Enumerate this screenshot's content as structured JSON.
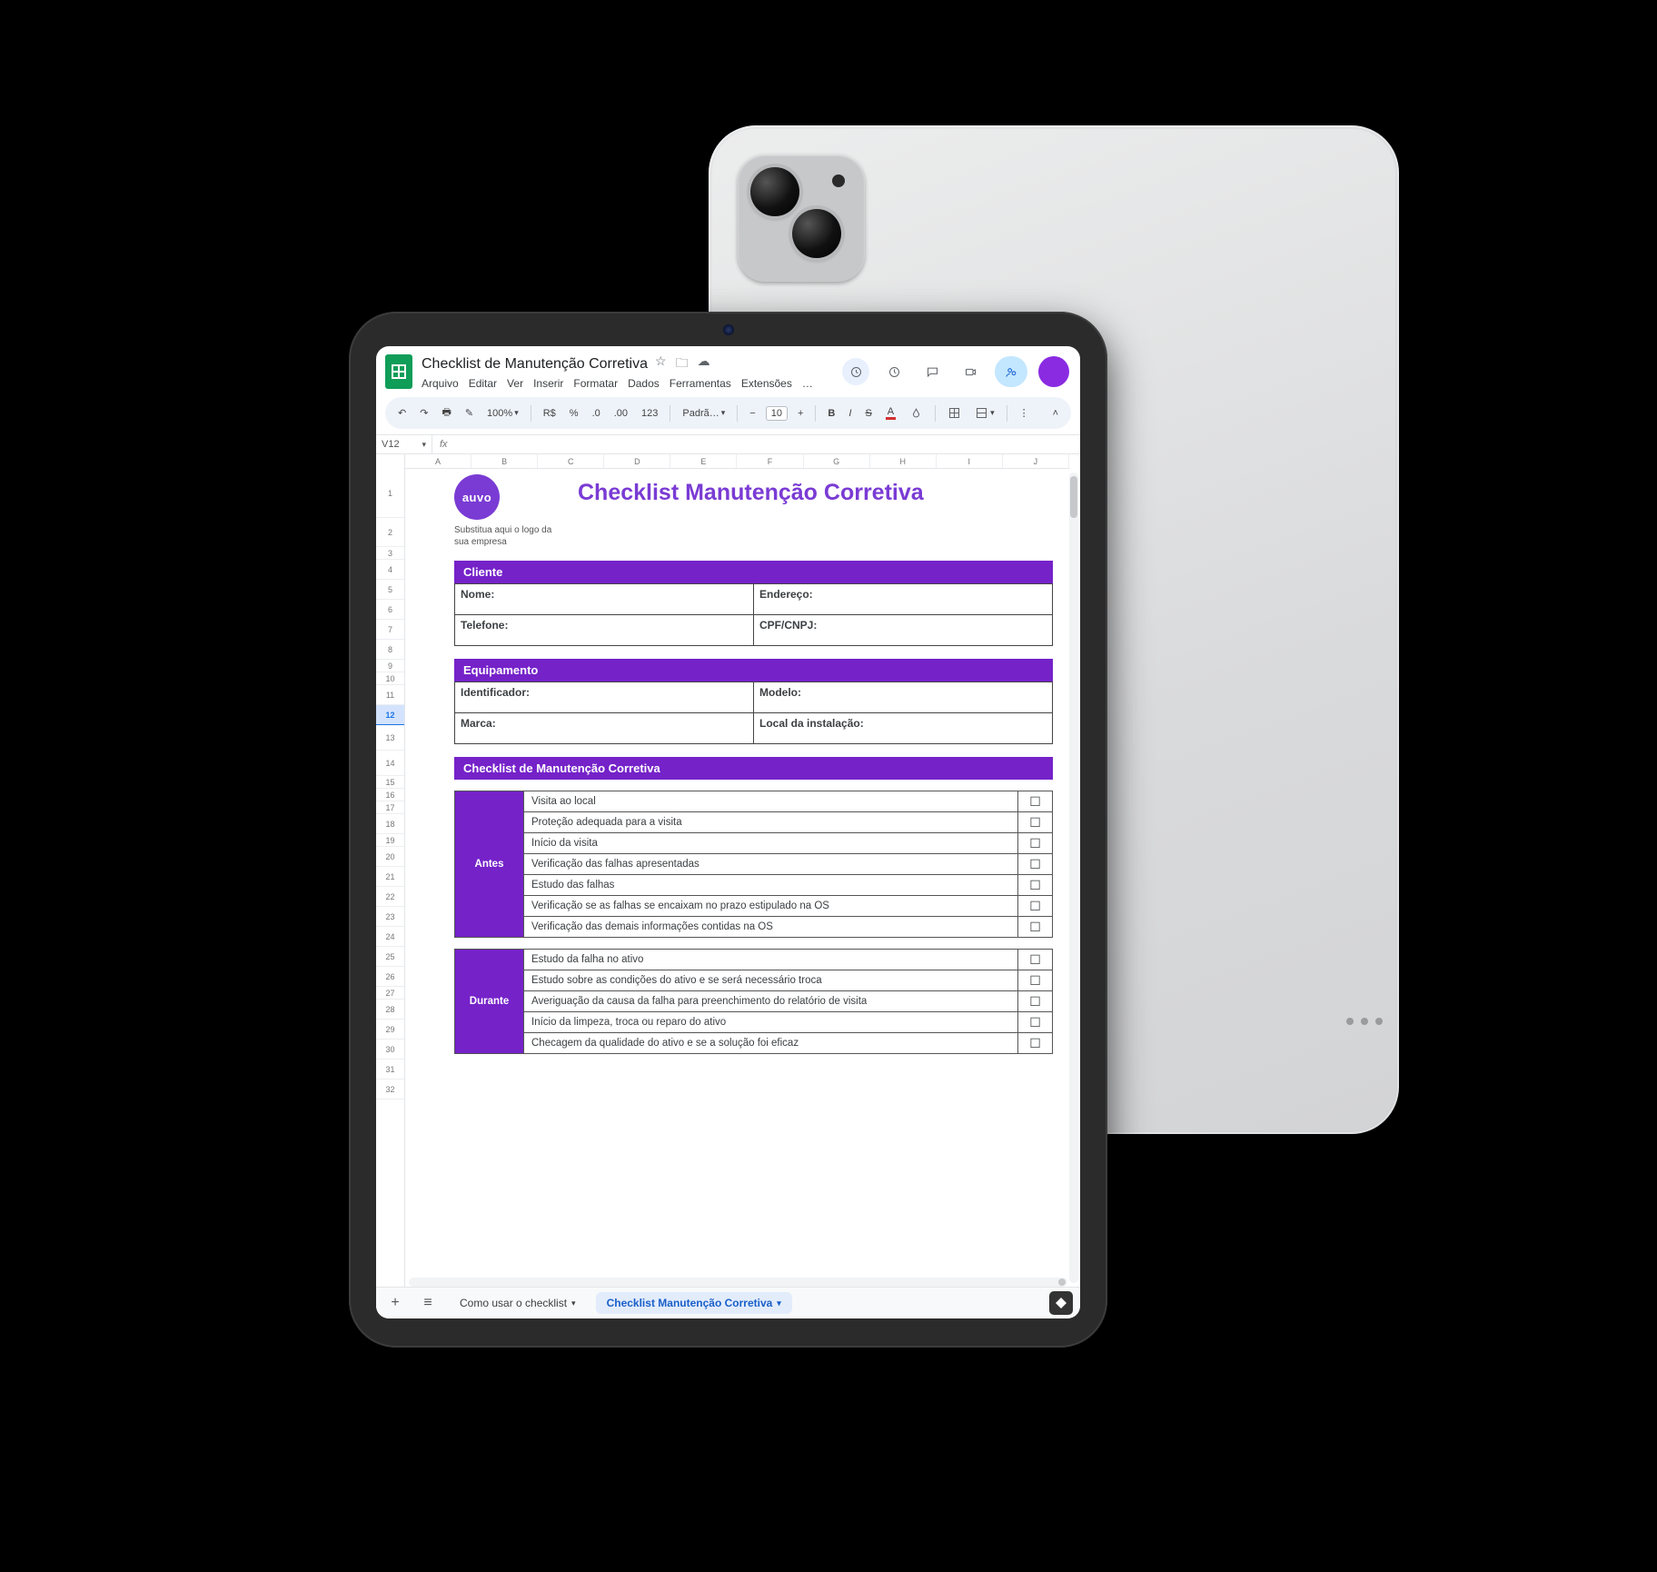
{
  "doc": {
    "title": "Checklist de Manutenção Corretiva",
    "menus": [
      "Arquivo",
      "Editar",
      "Ver",
      "Inserir",
      "Formatar",
      "Dados",
      "Ferramentas",
      "Extensões",
      "…"
    ]
  },
  "toolbar": {
    "zoom": "100%",
    "currency": "R$",
    "percent": "%",
    "dec_dec": ".0",
    "dec_inc": ".00",
    "num123": "123",
    "font": "Padrã…",
    "font_size": "10"
  },
  "fx": {
    "cell": "V12"
  },
  "columns": [
    "A",
    "B",
    "C",
    "D",
    "E",
    "F",
    "G",
    "H",
    "I",
    "J"
  ],
  "row_heights": [
    {
      "n": "1",
      "cls": "rh-tall"
    },
    {
      "n": "2",
      "cls": "rh-medhi"
    },
    {
      "n": "3",
      "cls": "rh-short"
    },
    {
      "n": "4",
      "cls": "rh-norm"
    },
    {
      "n": "5",
      "cls": "rh-norm"
    },
    {
      "n": "6",
      "cls": "rh-norm"
    },
    {
      "n": "7",
      "cls": "rh-norm"
    },
    {
      "n": "8",
      "cls": "rh-norm"
    },
    {
      "n": "9",
      "cls": "rh-short"
    },
    {
      "n": "10",
      "cls": "rh-short"
    },
    {
      "n": "11",
      "cls": "rh-norm"
    },
    {
      "n": "12",
      "cls": "rh-norm",
      "sel": true
    },
    {
      "n": "13",
      "cls": "rh-med"
    },
    {
      "n": "14",
      "cls": "rh-med"
    },
    {
      "n": "15",
      "cls": "rh-short"
    },
    {
      "n": "16",
      "cls": "rh-short"
    },
    {
      "n": "17",
      "cls": "rh-short"
    },
    {
      "n": "18",
      "cls": "rh-norm"
    },
    {
      "n": "19",
      "cls": "rh-short"
    },
    {
      "n": "20",
      "cls": "rh-norm"
    },
    {
      "n": "21",
      "cls": "rh-norm"
    },
    {
      "n": "22",
      "cls": "rh-norm"
    },
    {
      "n": "23",
      "cls": "rh-norm"
    },
    {
      "n": "24",
      "cls": "rh-norm"
    },
    {
      "n": "25",
      "cls": "rh-norm"
    },
    {
      "n": "26",
      "cls": "rh-norm"
    },
    {
      "n": "27",
      "cls": "rh-short"
    },
    {
      "n": "28",
      "cls": "rh-norm"
    },
    {
      "n": "29",
      "cls": "rh-norm"
    },
    {
      "n": "30",
      "cls": "rh-norm"
    },
    {
      "n": "31",
      "cls": "rh-norm"
    },
    {
      "n": "32",
      "cls": "rh-norm"
    }
  ],
  "page": {
    "logo_text": "auvo",
    "logo_sub": "Substitua aqui o logo da sua empresa",
    "title": "Checklist Manutenção Corretiva"
  },
  "sections": {
    "cliente": {
      "head": "Cliente",
      "fields": {
        "nome": "Nome:",
        "endereco": "Endereço:",
        "telefone": "Telefone:",
        "cpf": "CPF/CNPJ:"
      }
    },
    "equip": {
      "head": "Equipamento",
      "fields": {
        "ident": "Identificador:",
        "modelo": "Modelo:",
        "marca": "Marca:",
        "local": "Local da instalação:"
      }
    },
    "checklist": {
      "head": "Checklist de Manutenção Corretiva",
      "phases": [
        {
          "label": "Antes",
          "items": [
            "Visita ao local",
            "Proteção adequada para a visita",
            "Início da visita",
            "Verificação das falhas apresentadas",
            "Estudo das falhas",
            "Verificação se as falhas se encaixam no prazo estipulado na OS",
            "Verificação das demais informações contidas na OS"
          ]
        },
        {
          "label": "Durante",
          "items": [
            "Estudo da falha no ativo",
            "Estudo sobre as condições do ativo e se será necessário troca",
            "Averiguação da causa da falha para preenchimento do relatório de visita",
            "Início da limpeza, troca ou reparo do ativo",
            "Checagem da qualidade do ativo e se a solução foi eficaz"
          ]
        }
      ]
    }
  },
  "tabs": {
    "inactive": "Como usar o checklist",
    "active": "Checklist Manutenção Corretiva"
  }
}
